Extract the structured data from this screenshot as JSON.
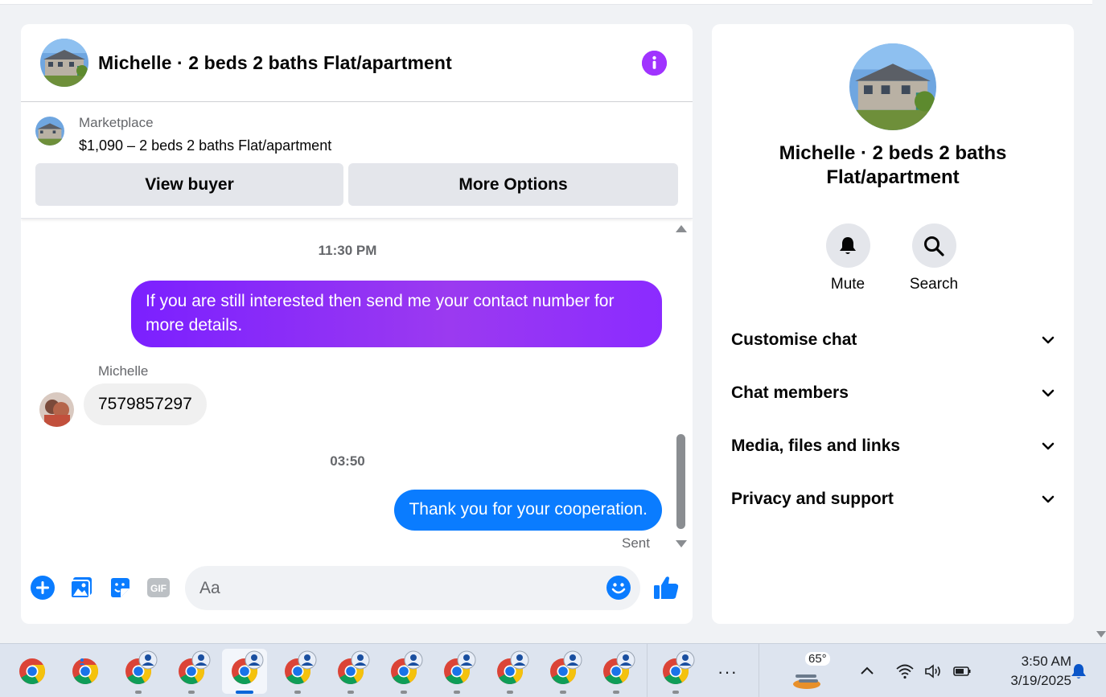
{
  "chat": {
    "title": "Michelle · 2 beds 2 baths Flat/apartment",
    "marketplace_label": "Marketplace",
    "listing": "$1,090 – 2 beds 2 baths Flat/apartment",
    "view_buyer": "View buyer",
    "more_options": "More Options"
  },
  "messages": {
    "time1": "11:30 PM",
    "out1": "If you are still interested then send me your contact number for more details.",
    "sender": "Michelle",
    "in1": "7579857297",
    "time2": "03:50",
    "out2": "Thank you for your cooperation.",
    "status": "Sent"
  },
  "composer": {
    "placeholder": "Aa"
  },
  "info": {
    "name": "Michelle · 2 beds 2 baths Flat/apartment",
    "mute": "Mute",
    "search": "Search",
    "sections": [
      "Customise chat",
      "Chat members",
      "Media, files and links",
      "Privacy and support"
    ]
  },
  "taskbar": {
    "more": "···",
    "temperature": "65°",
    "time": "3:50 AM",
    "date": "3/19/2025",
    "icons": [
      "chrome-icon",
      "chrome-profile-icon",
      "weather-icon",
      "chevron-up-icon",
      "wifi-icon",
      "volume-icon",
      "battery-icon",
      "notification-bell-icon"
    ]
  },
  "colors": {
    "accent_purple": "#a033ff",
    "bubble_blue": "#0a7cff",
    "messenger_blue": "#0a7cff"
  }
}
